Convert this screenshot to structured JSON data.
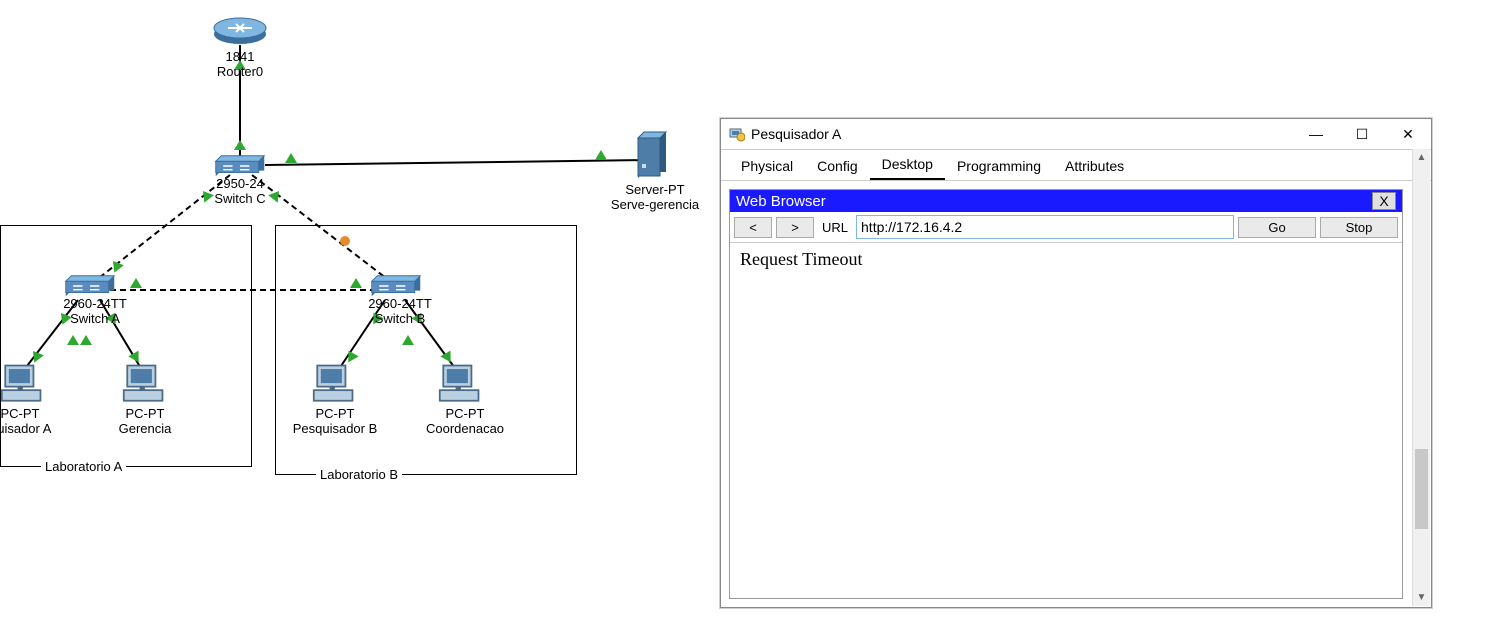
{
  "router": {
    "model": "1841",
    "name": "Router0"
  },
  "switchC": {
    "model": "2950-24",
    "name": "Switch C"
  },
  "switchA": {
    "model": "2960-24TT",
    "name": "Switch A"
  },
  "switchB": {
    "model": "2960-24TT",
    "name": "Switch B"
  },
  "server": {
    "model": "Server-PT",
    "name": "Serve-gerencia"
  },
  "pcA": {
    "model": "PC-PT",
    "name": "quisador A"
  },
  "pcGerencia": {
    "model": "PC-PT",
    "name": "Gerencia"
  },
  "pcB": {
    "model": "PC-PT",
    "name": "Pesquisador B"
  },
  "pcCoord": {
    "model": "PC-PT",
    "name": "Coordenacao"
  },
  "labA": {
    "label": "Laboratorio A"
  },
  "labB": {
    "label": "Laboratorio B"
  },
  "window": {
    "title": "Pesquisador A",
    "tabs": {
      "physical": "Physical",
      "config": "Config",
      "desktop": "Desktop",
      "programming": "Programming",
      "attributes": "Attributes"
    },
    "browser": {
      "title": "Web Browser",
      "close_label": "X",
      "back_label": "<",
      "fwd_label": ">",
      "url_label": "URL",
      "url_value": "http://172.16.4.2",
      "go_label": "Go",
      "stop_label": "Stop",
      "content": "Request Timeout"
    },
    "controls": {
      "minimize": "—",
      "maximize": "☐",
      "close": "✕"
    }
  }
}
